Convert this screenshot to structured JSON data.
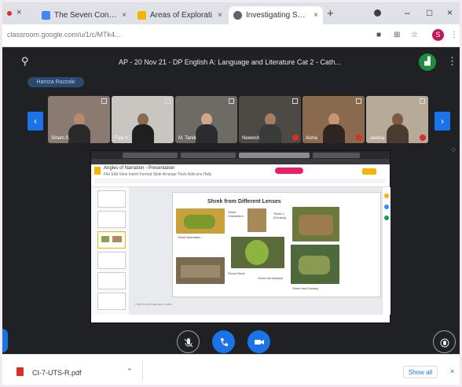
{
  "browser": {
    "tabs": [
      {
        "label": "The Seven Consecu",
        "fav_color": "#4285f4"
      },
      {
        "label": "Areas of Explorati",
        "fav_color": "#f4b400"
      },
      {
        "label": "Investigating Short",
        "fav_color": "#5f6368"
      }
    ],
    "active_tab_color": "#4285f4",
    "tab_close": "×",
    "new_tab": "+",
    "url": "classroom.google.com/u/1/c/MTk4...",
    "profile_initial": "S"
  },
  "meet": {
    "title": "AP - 20 Nov 21 - DP English A: Language and Literature Cat 2 - Cath...",
    "chip": "Hamza Razzaki",
    "participants": [
      {
        "name": "Siham S.",
        "bg": "#8a7a70",
        "skin": "#b58a6d",
        "shirt": "#2a2a2a",
        "muted": false
      },
      {
        "name": "Fiza V...",
        "bg": "#c9c6c2",
        "skin": "#8c6a52",
        "shirt": "#1f1f1f",
        "muted": false
      },
      {
        "name": "M. Tarek",
        "bg": "#6e6a64",
        "skin": "#d1a98a",
        "shirt": "#2b2b30",
        "muted": false
      },
      {
        "name": "Neelesh",
        "bg": "#4d4a46",
        "skin": "#a57d62",
        "shirt": "#3a3a3a",
        "muted": true
      },
      {
        "name": "Aisha",
        "bg": "#8a6a4e",
        "skin": "#c49577",
        "shirt": "#2e2420",
        "muted": true
      },
      {
        "name": "Javeria",
        "bg": "#b8aa98",
        "skin": "#7d5a44",
        "shirt": "#4a3c30",
        "muted": true
      }
    ],
    "controls": {
      "mic_icon": "mic-off-icon",
      "call_icon": "call-end-icon",
      "camera_icon": "camera-icon",
      "hand_icon": "raise-hand-icon"
    }
  },
  "slides": {
    "doc_title": "Angles of Narration - Presentation",
    "menu": "File Edit View Insert Format Slide Arrange Tools Add-ons Help",
    "slide_title": "Shrek from Different Lenses",
    "captions": [
      "Shrek Animation...",
      "Shrek Characters",
      "Shrek 2 (Donkey)",
      "Fiona Shrek",
      "Shrek the Musical",
      "Shrek and Donkey"
    ],
    "notes": "Click to add speaker notes"
  },
  "downloads": {
    "file": "CI-7-UTS-R.pdf",
    "show_all": "Show all"
  }
}
